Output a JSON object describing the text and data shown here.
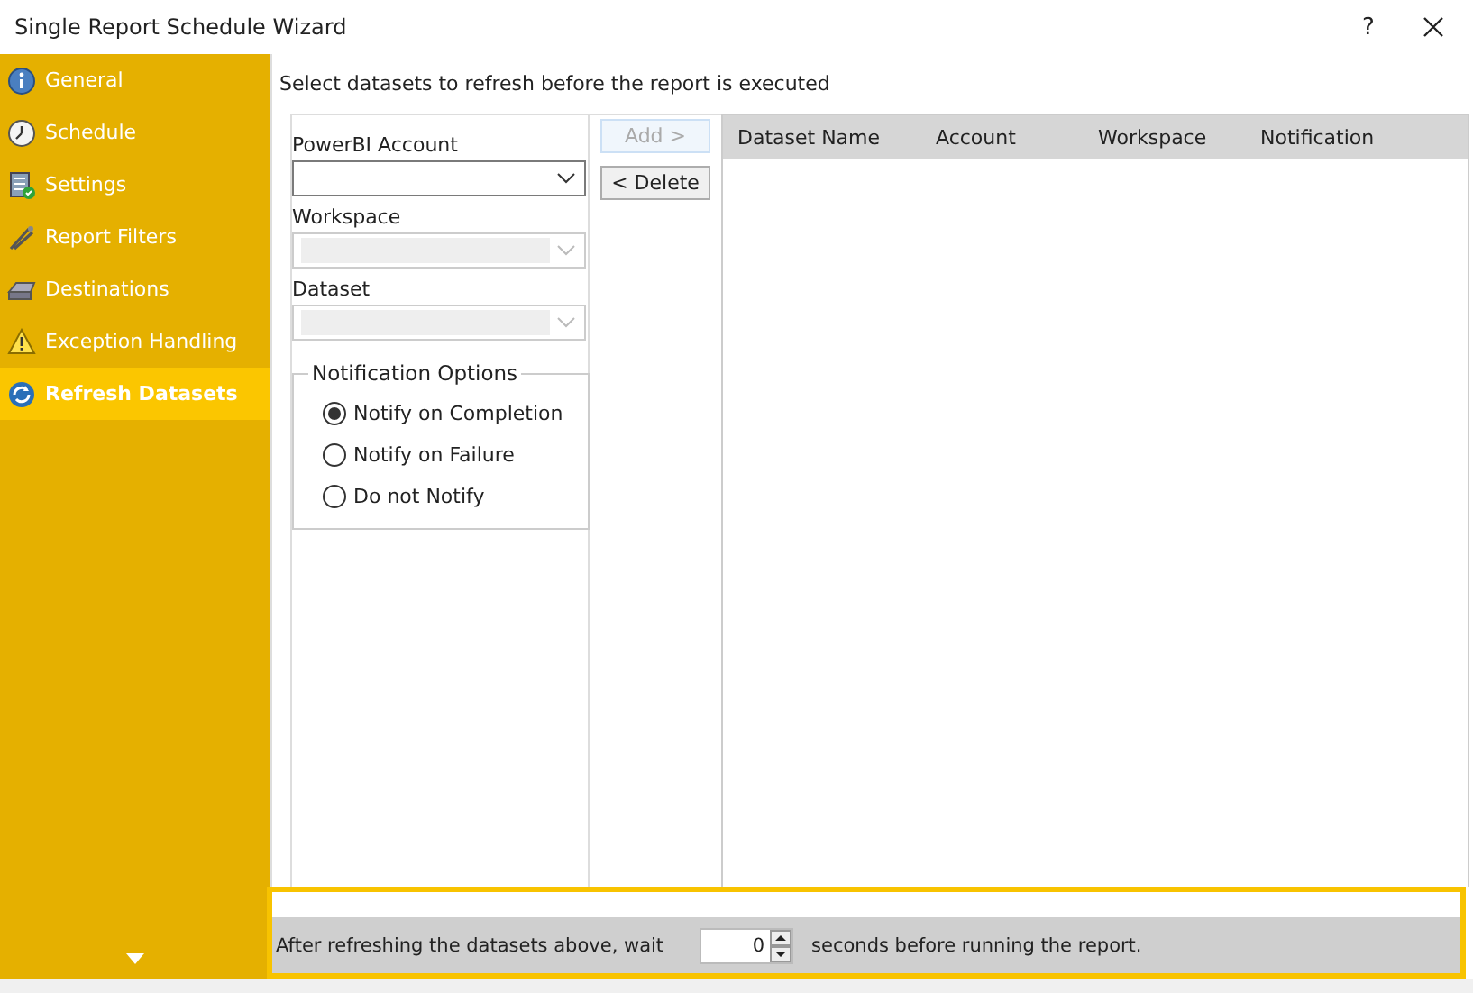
{
  "window": {
    "title": "Single Report Schedule Wizard",
    "help": "?"
  },
  "sidebar": {
    "items": [
      {
        "label": "General",
        "kind": "info",
        "selected": false
      },
      {
        "label": "Schedule",
        "kind": "clock",
        "selected": false
      },
      {
        "label": "Settings",
        "kind": "settings",
        "selected": false
      },
      {
        "label": "Report Filters",
        "kind": "filter",
        "selected": false
      },
      {
        "label": "Destinations",
        "kind": "drive",
        "selected": false
      },
      {
        "label": "Exception Handling",
        "kind": "warning",
        "selected": false
      },
      {
        "label": "Refresh Datasets",
        "kind": "refresh",
        "selected": true
      }
    ]
  },
  "instruction": "Select datasets to refresh before the report is executed",
  "fields": [
    {
      "label": "PowerBI Account",
      "disabled": false
    },
    {
      "label": "Workspace",
      "disabled": true
    },
    {
      "label": "Dataset",
      "disabled": true
    }
  ],
  "notification_options": {
    "title": "Notification Options",
    "options": [
      {
        "label": "Notify on Completion",
        "selected": true
      },
      {
        "label": "Notify on Failure",
        "selected": false
      },
      {
        "label": "Do not Notify",
        "selected": false
      }
    ]
  },
  "buttons": [
    {
      "label": "Add >",
      "disabled": true
    },
    {
      "label": "< Delete",
      "disabled": false
    }
  ],
  "table": {
    "columns": [
      "Dataset Name",
      "Account",
      "Workspace",
      "Notification"
    ]
  },
  "wait": {
    "before": "After refreshing the datasets above, wait",
    "value": "0",
    "after": "seconds before running the report."
  }
}
